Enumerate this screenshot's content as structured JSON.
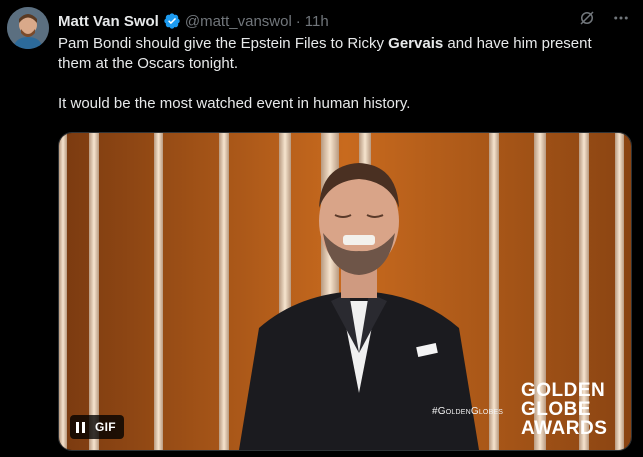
{
  "tweet": {
    "author_name": "Matt Van Swol",
    "handle": "@matt_vanswol",
    "separator": "·",
    "time": "11h",
    "line1_pre": "Pam Bondi should give the Epstein Files to Ricky ",
    "line1_bold": "Gervais",
    "line1_post": " and have him present them at the Oscars tonight.",
    "line2": "It would be the most watched event in human history."
  },
  "media": {
    "type": "gif",
    "badge_label": "GIF",
    "hashtag": "#GoldenGlobes",
    "logo_line1": "GOLDEN",
    "logo_line2": "GLOBE",
    "logo_line3": "AWARDS"
  },
  "icons": {
    "verified": "verified-badge-icon",
    "grok": "grok-icon",
    "more": "more-icon",
    "pause": "pause-icon"
  },
  "colors": {
    "background": "#000000",
    "text": "#e7e9ea",
    "muted": "#71767b",
    "verified": "#1d9bf0"
  }
}
